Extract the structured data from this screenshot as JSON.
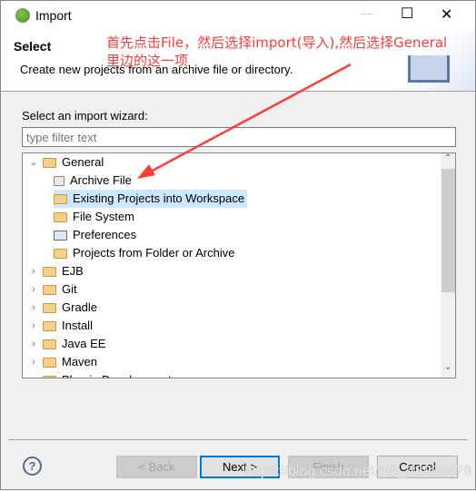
{
  "window": {
    "title": "Import",
    "minimize": "—",
    "maximize": "☐",
    "close": "✕"
  },
  "header": {
    "title": "Select",
    "description": "Create new projects from an archive file or directory."
  },
  "annotation": {
    "line1": "首先点击File，然后选择import(导入),然后选择General",
    "line2": "里边的这一项",
    "color": "#ff3b3b"
  },
  "wizard": {
    "label": "Select an import wizard:",
    "filter_placeholder": "type filter text"
  },
  "tree": {
    "general": {
      "label": "General",
      "expanded": true,
      "children": [
        "Archive File",
        "Existing Projects into Workspace",
        "File System",
        "Preferences",
        "Projects from Folder or Archive"
      ],
      "selected": "Existing Projects into Workspace"
    },
    "categories": [
      "EJB",
      "Git",
      "Gradle",
      "Install",
      "Java EE",
      "Maven",
      "Plug-in Development"
    ]
  },
  "buttons": {
    "back": "< Back",
    "next": "Next >",
    "finish": "Finish",
    "cancel": "Cancel",
    "help": "?"
  },
  "watermark": "https://blog.csdn.net/m0_48938479"
}
